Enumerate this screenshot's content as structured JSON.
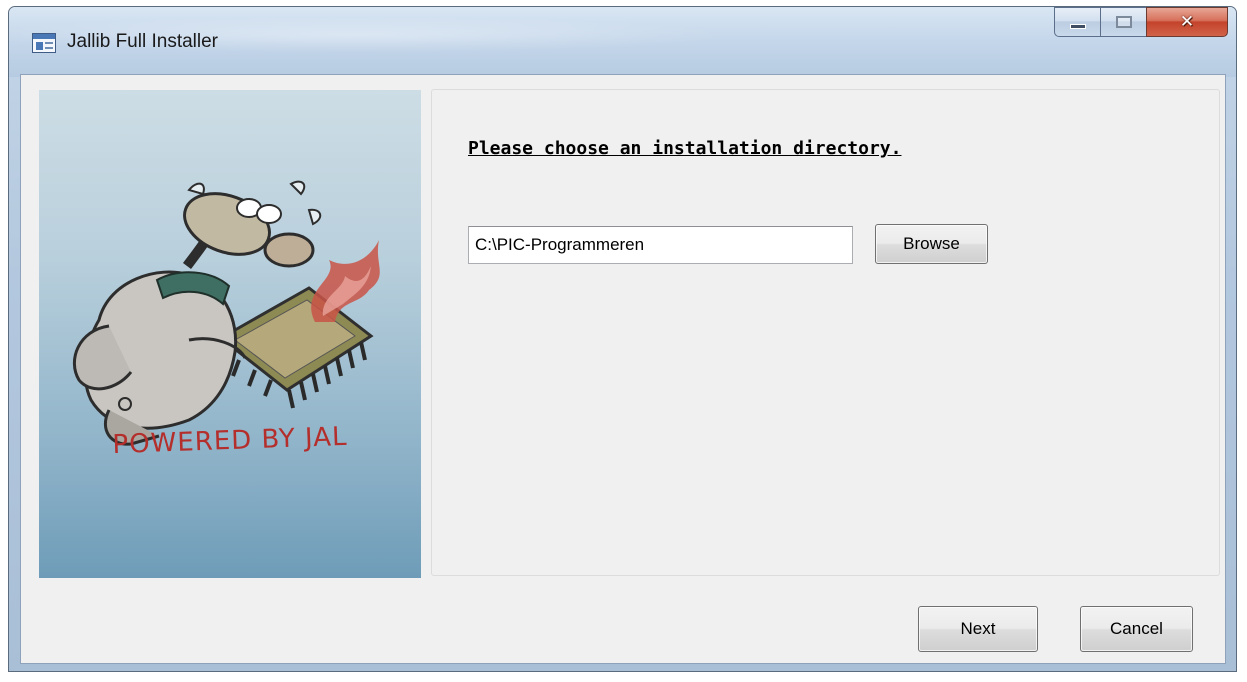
{
  "window": {
    "title": "Jallib Full Installer",
    "icons": {
      "app": "window-app-icon",
      "minimize": "minimize-icon",
      "maximize": "maximize-icon",
      "close": "close-icon"
    }
  },
  "sidebar_image": {
    "description_icon": "jal-mascot-illustration",
    "caption": "POWERED BY JAL"
  },
  "main": {
    "heading": "Please choose an installation directory.",
    "directory_field": {
      "value": "C:\\PIC-Programmeren"
    },
    "browse_label": "Browse"
  },
  "footer": {
    "next_label": "Next",
    "cancel_label": "Cancel"
  }
}
